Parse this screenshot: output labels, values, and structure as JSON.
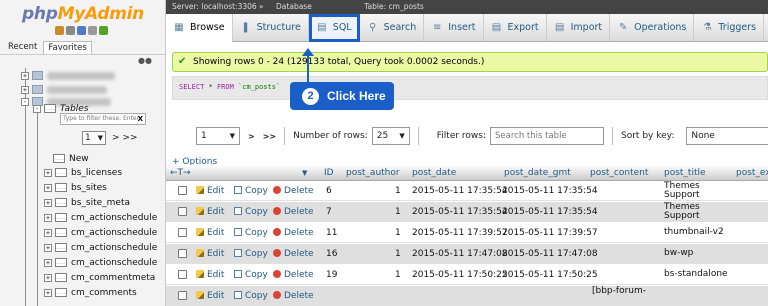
{
  "nav": {
    "logo_php": "php",
    "logo_my": "MyAdmin",
    "tabs": [
      "Recent",
      "Favorites"
    ],
    "tables_label": "Tables",
    "filter_placeholder": "Type to filter these, Enter",
    "filter_clear": "X",
    "page_select": "1",
    "page_next": "> >>",
    "new_label": "New",
    "tables": [
      "bs_licenses",
      "bs_sites",
      "bs_site_meta",
      "cm_actionschedule",
      "cm_actionschedule",
      "cm_actionschedule",
      "cm_actionschedule",
      "cm_commentmeta",
      "cm_comments"
    ]
  },
  "breadcrumb": {
    "server": "Server: localhost:3306 »",
    "database": "Database",
    "table": "Table: cm_posts"
  },
  "tabs": [
    {
      "label": "Browse",
      "icon": "browse-icon"
    },
    {
      "label": "Structure",
      "icon": "structure-icon"
    },
    {
      "label": "SQL",
      "icon": "sql-icon"
    },
    {
      "label": "Search",
      "icon": "search-icon"
    },
    {
      "label": "Insert",
      "icon": "insert-icon"
    },
    {
      "label": "Export",
      "icon": "export-icon"
    },
    {
      "label": "Import",
      "icon": "import-icon"
    },
    {
      "label": "Operations",
      "icon": "operations-icon"
    },
    {
      "label": "Triggers",
      "icon": "triggers-icon"
    }
  ],
  "message": "Showing rows 0 - 24 (129133 total, Query took 0.0002 seconds.)",
  "sql": {
    "select": "SELECT",
    "star": " * ",
    "from": "FROM",
    "table": " `cm_posts`"
  },
  "callout": {
    "number": "2",
    "text": "Click Here"
  },
  "pager": {
    "page": "1",
    "next": ">",
    "last": ">>",
    "rows_label": "Number of rows:",
    "rows_value": "25",
    "filter_label": "Filter rows:",
    "filter_placeholder": "Search this table",
    "sort_label": "Sort by key:",
    "sort_value": "None"
  },
  "options_label": "+ Options",
  "arrows_label": "←T→",
  "columns": [
    "ID",
    "post_author",
    "post_date",
    "post_date_gmt",
    "post_content",
    "post_title",
    "post_ex"
  ],
  "actions": {
    "edit": "Edit",
    "copy": "Copy",
    "delete": "Delete"
  },
  "rows": [
    {
      "id": "6",
      "author": "1",
      "date": "2015-05-11 17:35:54",
      "gmt": "2015-05-11 17:35:54",
      "content": "",
      "title": "Themes",
      "title2": "Support"
    },
    {
      "id": "7",
      "author": "1",
      "date": "2015-05-11 17:35:54",
      "gmt": "2015-05-11 17:35:54",
      "content": "",
      "title": "Themes",
      "title2": "Support"
    },
    {
      "id": "11",
      "author": "1",
      "date": "2015-05-11 17:39:57",
      "gmt": "2015-05-11 17:39:57",
      "content": "",
      "title": "thumbnail-v2",
      "title2": ""
    },
    {
      "id": "16",
      "author": "1",
      "date": "2015-05-11 17:47:08",
      "gmt": "2015-05-11 17:47:08",
      "content": "",
      "title": "bw-wp",
      "title2": ""
    },
    {
      "id": "19",
      "author": "1",
      "date": "2015-05-11 17:50:25",
      "gmt": "2015-05-11 17:50:25",
      "content": "",
      "title": "bs-standalone",
      "title2": ""
    },
    {
      "id": "",
      "author": "",
      "date": "",
      "gmt": "",
      "content": "[bbp-forum-",
      "title": "",
      "title2": ""
    }
  ]
}
